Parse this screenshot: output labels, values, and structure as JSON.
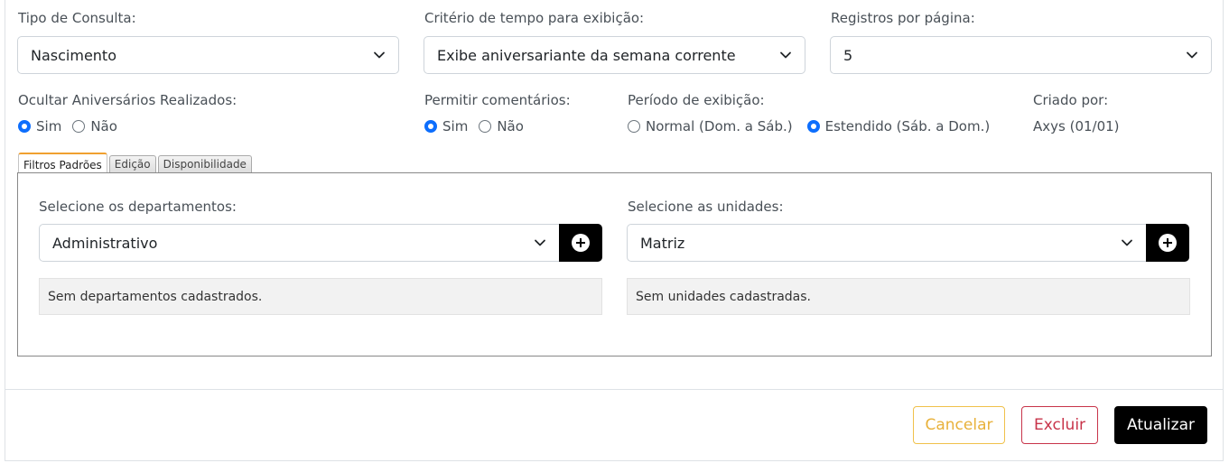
{
  "form": {
    "tipo_consulta": {
      "label": "Tipo de Consulta:",
      "value": "Nascimento"
    },
    "criterio_tempo": {
      "label": "Critério de tempo para exibição:",
      "value": "Exibe aniversariante da semana corrente"
    },
    "registros_pagina": {
      "label": "Registros por página:",
      "value": "5"
    },
    "ocultar_aniversarios": {
      "label": "Ocultar Aniversários Realizados:",
      "options": [
        {
          "label": "Sim",
          "checked": true
        },
        {
          "label": "Não",
          "checked": false
        }
      ]
    },
    "permitir_comentarios": {
      "label": "Permitir comentários:",
      "options": [
        {
          "label": "Sim",
          "checked": true
        },
        {
          "label": "Não",
          "checked": false
        }
      ]
    },
    "periodo_exibicao": {
      "label": "Período de exibição:",
      "options": [
        {
          "label": "Normal (Dom. a Sáb.)",
          "checked": false
        },
        {
          "label": "Estendido (Sáb. a Dom.)",
          "checked": true
        }
      ]
    },
    "criado_por": {
      "label": "Criado por:",
      "value": "Axys (01/01)"
    }
  },
  "tabs": [
    {
      "label": "Filtros Padrões",
      "active": true
    },
    {
      "label": "Edição",
      "active": false
    },
    {
      "label": "Disponibilidade",
      "active": false
    }
  ],
  "filters": {
    "departamentos": {
      "label": "Selecione os departamentos:",
      "value": "Administrativo",
      "empty_message": "Sem departamentos cadastrados."
    },
    "unidades": {
      "label": "Selecione as unidades:",
      "value": "Matriz",
      "empty_message": "Sem unidades cadastradas."
    }
  },
  "actions": {
    "cancel": "Cancelar",
    "delete": "Excluir",
    "update": "Atualizar"
  },
  "icons": {
    "dropdown": "chevron-down-icon",
    "add": "plus-circle-icon"
  },
  "colors": {
    "radio_checked": "#0d6efd",
    "cancel": "#e8b13a",
    "delete": "#c8344a",
    "update_bg": "#000000",
    "active_tab_top": "#f0a030"
  }
}
